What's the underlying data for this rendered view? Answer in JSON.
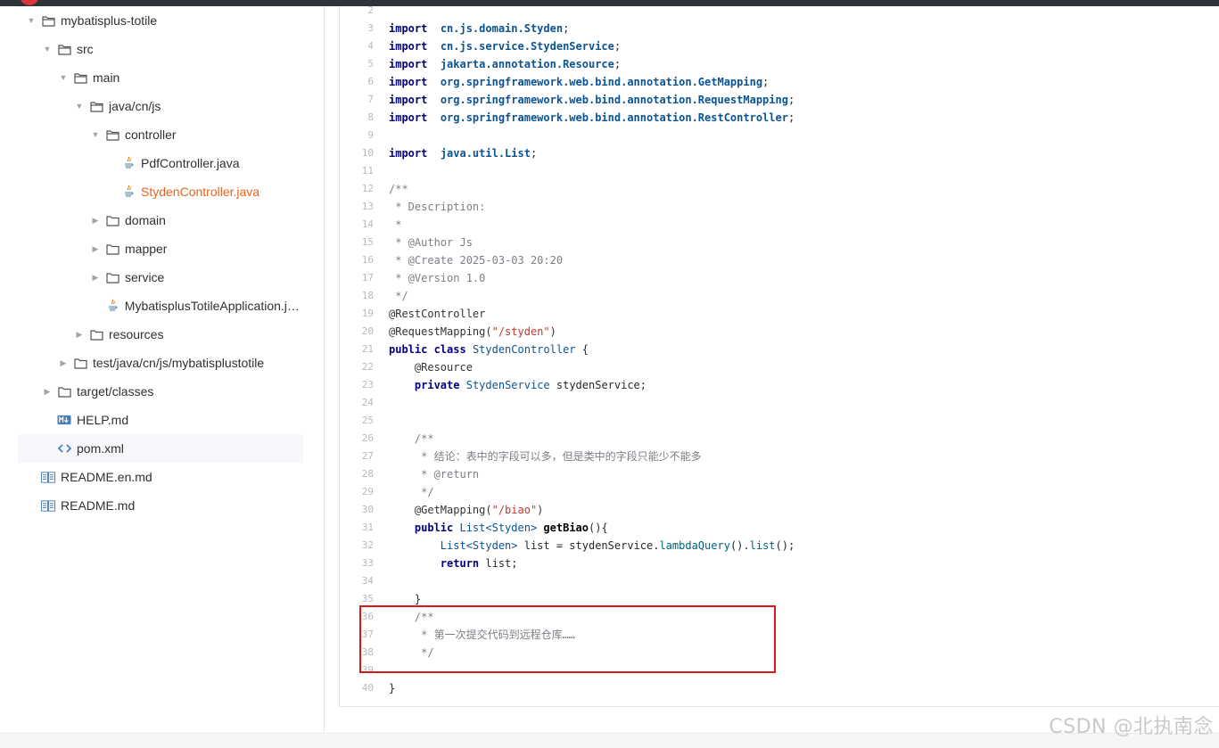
{
  "tree": [
    {
      "label": "mybatisplus-totile",
      "icon": "folder-open-icon",
      "caret": "down",
      "depth": 0
    },
    {
      "label": "src",
      "icon": "folder-open-icon",
      "caret": "down",
      "depth": 1
    },
    {
      "label": "main",
      "icon": "folder-open-icon",
      "caret": "down",
      "depth": 2
    },
    {
      "label": "java/cn/js",
      "icon": "folder-open-icon",
      "caret": "down",
      "depth": 3
    },
    {
      "label": "controller",
      "icon": "folder-open-icon",
      "caret": "down",
      "depth": 4
    },
    {
      "label": "PdfController.java",
      "icon": "java-file-icon",
      "caret": "none",
      "depth": 5
    },
    {
      "label": "StydenController.java",
      "icon": "java-file-icon",
      "caret": "none",
      "depth": 5,
      "active": true
    },
    {
      "label": "domain",
      "icon": "folder-icon",
      "caret": "right",
      "depth": 4
    },
    {
      "label": "mapper",
      "icon": "folder-icon",
      "caret": "right",
      "depth": 4
    },
    {
      "label": "service",
      "icon": "folder-icon",
      "caret": "right",
      "depth": 4
    },
    {
      "label": "MybatisplusTotileApplication.ja...",
      "icon": "java-file-icon",
      "caret": "none",
      "depth": 4
    },
    {
      "label": "resources",
      "icon": "folder-icon",
      "caret": "right",
      "depth": 3
    },
    {
      "label": "test/java/cn/js/mybatisplustotile",
      "icon": "folder-icon",
      "caret": "right",
      "depth": 2
    },
    {
      "label": "target/classes",
      "icon": "folder-icon",
      "caret": "right",
      "depth": 1
    },
    {
      "label": "HELP.md",
      "icon": "markdown-icon",
      "caret": "none",
      "depth": 1
    },
    {
      "label": "pom.xml",
      "icon": "code-file-icon",
      "caret": "none",
      "depth": 1,
      "selected": true
    },
    {
      "label": "README.en.md",
      "icon": "readme-icon",
      "caret": "none",
      "depth": 0
    },
    {
      "label": "README.md",
      "icon": "readme-icon",
      "caret": "none",
      "depth": 0
    }
  ],
  "code": [
    {
      "n": "2",
      "t": []
    },
    {
      "n": "3",
      "t": [
        [
          "kw",
          "import"
        ],
        [
          "",
          "  "
        ],
        [
          "pkg",
          "cn.js.domain.Styden"
        ],
        [
          "",
          ";"
        ]
      ]
    },
    {
      "n": "4",
      "t": [
        [
          "kw",
          "import"
        ],
        [
          "",
          "  "
        ],
        [
          "pkg",
          "cn.js.service.StydenService"
        ],
        [
          "",
          ";"
        ]
      ]
    },
    {
      "n": "5",
      "t": [
        [
          "kw",
          "import"
        ],
        [
          "",
          "  "
        ],
        [
          "pkg",
          "jakarta.annotation.Resource"
        ],
        [
          "",
          ";"
        ]
      ]
    },
    {
      "n": "6",
      "t": [
        [
          "kw",
          "import"
        ],
        [
          "",
          "  "
        ],
        [
          "pkg",
          "org.springframework.web.bind.annotation.GetMapping"
        ],
        [
          "",
          ";"
        ]
      ]
    },
    {
      "n": "7",
      "t": [
        [
          "kw",
          "import"
        ],
        [
          "",
          "  "
        ],
        [
          "pkg",
          "org.springframework.web.bind.annotation.RequestMapping"
        ],
        [
          "",
          ";"
        ]
      ]
    },
    {
      "n": "8",
      "t": [
        [
          "kw",
          "import"
        ],
        [
          "",
          "  "
        ],
        [
          "pkg",
          "org.springframework.web.bind.annotation.RestController"
        ],
        [
          "",
          ";"
        ]
      ]
    },
    {
      "n": "9",
      "t": []
    },
    {
      "n": "10",
      "t": [
        [
          "kw",
          "import"
        ],
        [
          "",
          "  "
        ],
        [
          "pkg",
          "java.util.List"
        ],
        [
          "",
          ";"
        ]
      ]
    },
    {
      "n": "11",
      "t": []
    },
    {
      "n": "12",
      "t": [
        [
          "cmt",
          "/**"
        ]
      ]
    },
    {
      "n": "13",
      "t": [
        [
          "cmt",
          " * Description:"
        ]
      ]
    },
    {
      "n": "14",
      "t": [
        [
          "cmt",
          " *"
        ]
      ]
    },
    {
      "n": "15",
      "t": [
        [
          "cmt",
          " * @Author Js"
        ]
      ]
    },
    {
      "n": "16",
      "t": [
        [
          "cmt",
          " * @Create 2025-03-03 20:20"
        ]
      ]
    },
    {
      "n": "17",
      "t": [
        [
          "cmt",
          " * @Version 1.0"
        ]
      ]
    },
    {
      "n": "18",
      "t": [
        [
          "cmt",
          " */"
        ]
      ]
    },
    {
      "n": "19",
      "t": [
        [
          "ann",
          "@RestController"
        ]
      ]
    },
    {
      "n": "20",
      "t": [
        [
          "ann",
          "@RequestMapping("
        ],
        [
          "str",
          "\"/styden\""
        ],
        [
          "ann",
          ")"
        ]
      ]
    },
    {
      "n": "21",
      "t": [
        [
          "kw",
          "public class"
        ],
        [
          "",
          " "
        ],
        [
          "cls",
          "StydenController"
        ],
        [
          "",
          " {"
        ]
      ]
    },
    {
      "n": "22",
      "t": [
        [
          "ann",
          "    @Resource"
        ]
      ]
    },
    {
      "n": "23",
      "t": [
        [
          "kw",
          "    private"
        ],
        [
          "",
          " "
        ],
        [
          "cls",
          "StydenService"
        ],
        [
          "",
          " stydenService;"
        ]
      ]
    },
    {
      "n": "24",
      "t": []
    },
    {
      "n": "25",
      "t": []
    },
    {
      "n": "26",
      "t": [
        [
          "cmt",
          "    /**"
        ]
      ]
    },
    {
      "n": "27",
      "t": [
        [
          "cmt",
          "     * 结论：表中的字段可以多，但是类中的字段只能少不能多"
        ]
      ]
    },
    {
      "n": "28",
      "t": [
        [
          "cmt",
          "     * @return"
        ]
      ]
    },
    {
      "n": "29",
      "t": [
        [
          "cmt",
          "     */"
        ]
      ]
    },
    {
      "n": "30",
      "t": [
        [
          "ann",
          "    @GetMapping("
        ],
        [
          "str",
          "\"/biao\""
        ],
        [
          "ann",
          ")"
        ]
      ]
    },
    {
      "n": "31",
      "t": [
        [
          "kw",
          "    public"
        ],
        [
          "",
          " "
        ],
        [
          "cls",
          "List<Styden>"
        ],
        [
          "",
          " "
        ],
        [
          "fn",
          "getBiao"
        ],
        [
          "",
          "(){"
        ]
      ]
    },
    {
      "n": "32",
      "t": [
        [
          "",
          "        "
        ],
        [
          "cls",
          "List<Styden>"
        ],
        [
          "",
          " list = stydenService."
        ],
        [
          "mth",
          "lambdaQuery"
        ],
        [
          "",
          "()."
        ],
        [
          "mth",
          "list"
        ],
        [
          "",
          "();"
        ]
      ]
    },
    {
      "n": "33",
      "t": [
        [
          "kw",
          "        return"
        ],
        [
          "",
          " list;"
        ]
      ]
    },
    {
      "n": "34",
      "t": []
    },
    {
      "n": "35",
      "t": [
        [
          "",
          "    }"
        ]
      ]
    },
    {
      "n": "36",
      "t": [
        [
          "cmt",
          "    /**"
        ]
      ]
    },
    {
      "n": "37",
      "t": [
        [
          "cmt",
          "     * 第一次提交代码到远程仓库……"
        ]
      ]
    },
    {
      "n": "38",
      "t": [
        [
          "cmt",
          "     */"
        ]
      ]
    },
    {
      "n": "39",
      "t": []
    },
    {
      "n": "40",
      "t": [
        [
          "",
          "}"
        ]
      ]
    }
  ],
  "watermark": "CSDN @北执南念",
  "colors": {
    "active_file": "#e6641a",
    "highlight_box": "#d7191c",
    "keyword": "#000080",
    "string": "#c0392b",
    "comment": "#7b7f86"
  }
}
